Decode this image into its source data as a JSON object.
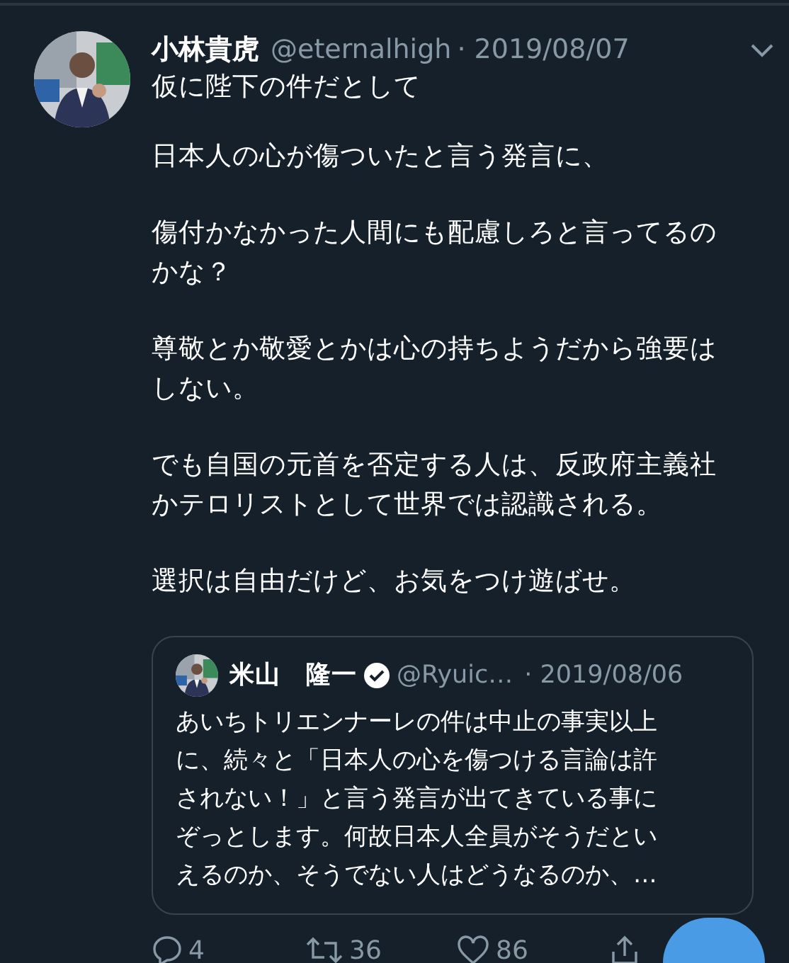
{
  "tweet": {
    "author": {
      "name": "小林貴虎",
      "handle": "@eternalhigh",
      "date": "· 2019/08/07",
      "avatar": {
        "kind": "picture"
      }
    },
    "paragraphs": [
      [
        "仮に陛下の件だとして"
      ],
      [
        "日本人の心が傷ついたと言う発言に、"
      ],
      [
        "傷付かなかった人間にも配慮しろと言ってるの",
        "かな？"
      ],
      [
        "尊敬とか敬愛とかは心の持ちようだから強要は",
        "しない。"
      ],
      [
        "でも自国の元首を否定する人は、反政府主義社",
        "かテロリストとして世界では認識される。"
      ],
      [
        "選択は自由だけど、お気をつけ遊ばせ。"
      ]
    ],
    "quoted": {
      "name": "米山　隆一",
      "verified": true,
      "handle": "@Ryuic…",
      "date": "· 2019/08/06",
      "avatar": {
        "kind": "picture"
      },
      "lines": [
        "あいちトリエンナーレの件は中止の事実以上",
        "に、続々と「日本人の心を傷つける言論は許",
        "されない！」と言う発言が出てきている事に",
        "ぞっとします。何故日本人全員がそうだとい",
        "えるのか、そうでない人はどうなるのか、…"
      ]
    },
    "actions": {
      "replies": "4",
      "retweets": "36",
      "likes": "86"
    }
  }
}
